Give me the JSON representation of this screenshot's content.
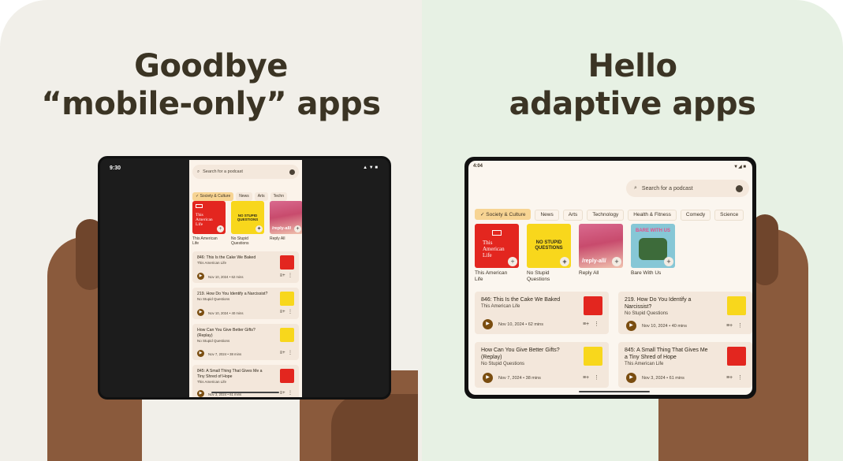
{
  "left_panel": {
    "headline_line1": "Goodbye",
    "headline_line2": "“mobile-only” apps",
    "device": {
      "status_time": "9:30",
      "status_icons": "▲ ▼ ■",
      "search_placeholder": "Search for a podcast",
      "chips": [
        "Society & Culture",
        "News",
        "Arts",
        "Techn"
      ],
      "shows": [
        {
          "title_l1": "This American",
          "title_l2": "Life"
        },
        {
          "title_l1": "No Stupid",
          "title_l2": "Questions"
        },
        {
          "title_l1": "Reply All",
          "title_l2": ""
        }
      ],
      "episodes": [
        {
          "title_l1": "846: This Is the Cake We Baked",
          "title_l2": "",
          "show": "This American Life",
          "meta": "Nov 10, 2024 • 62 mins"
        },
        {
          "title_l1": "219. How Do You Identify a Narcissist?",
          "title_l2": "",
          "show": "No Stupid Questions",
          "meta": "Nov 10, 2024 • 40 mins"
        },
        {
          "title_l1": "How Can You Give Better Gifts?",
          "title_l2": "(Replay)",
          "show": "No Stupid Questions",
          "meta": "Nov 7, 2024 • 38 mins"
        },
        {
          "title_l1": "845: A Small Thing That Gives Me a",
          "title_l2": "Tiny Shred of Hope",
          "show": "This American Life",
          "meta": "Nov 3, 2024 • 61 mins"
        }
      ]
    }
  },
  "right_panel": {
    "headline_line1": "Hello",
    "headline_line2": "adaptive apps",
    "device": {
      "status_time": "4:04",
      "status_icons": "▼◢ ■",
      "search_placeholder": "Search for a podcast",
      "chips": [
        "Society & Culture",
        "News",
        "Arts",
        "Technology",
        "Health & Fitness",
        "Comedy",
        "Science"
      ],
      "shows": [
        {
          "title_l1": "This American",
          "title_l2": "Life"
        },
        {
          "title_l1": "No Stupid",
          "title_l2": "Questions"
        },
        {
          "title_l1": "Reply All",
          "title_l2": ""
        },
        {
          "title_l1": "Bare With Us",
          "title_l2": ""
        }
      ],
      "episodes": [
        {
          "title_l1": "846: This Is the Cake We Baked",
          "title_l2": "",
          "show": "This American Life",
          "meta": "Nov 10, 2024 • 62 mins"
        },
        {
          "title_l1": "219. How Do You Identify a",
          "title_l2": "Narcissist?",
          "show": "No Stupid Questions",
          "meta": "Nov 10, 2024 • 40 mins"
        },
        {
          "title_l1": "How Can You Give Better Gifts?",
          "title_l2": "(Replay)",
          "show": "No Stupid Questions",
          "meta": "Nov 7, 2024 • 38 mins"
        },
        {
          "title_l1": "845: A Small Thing That Gives Me",
          "title_l2": "a Tiny Shred of Hope",
          "show": "This American Life",
          "meta": "Nov 3, 2024 • 61 mins"
        }
      ]
    }
  },
  "cover_art": {
    "tal_l1": "This",
    "tal_l2": "American",
    "tal_l3": "Life",
    "nsq_l1": "NO STUPID",
    "nsq_l2": "QUESTIONS",
    "reply_all": "/reply-all/",
    "bare_with_us": "BARE WITH US"
  },
  "colors": {
    "left_bg": "#f1efe9",
    "right_bg": "#e7f1e4",
    "headline": "#3b3424",
    "accent_chip": "#f7d493",
    "play_button": "#7a4d10",
    "tal_red": "#e3261f",
    "nsq_yellow": "#f8d71c"
  }
}
